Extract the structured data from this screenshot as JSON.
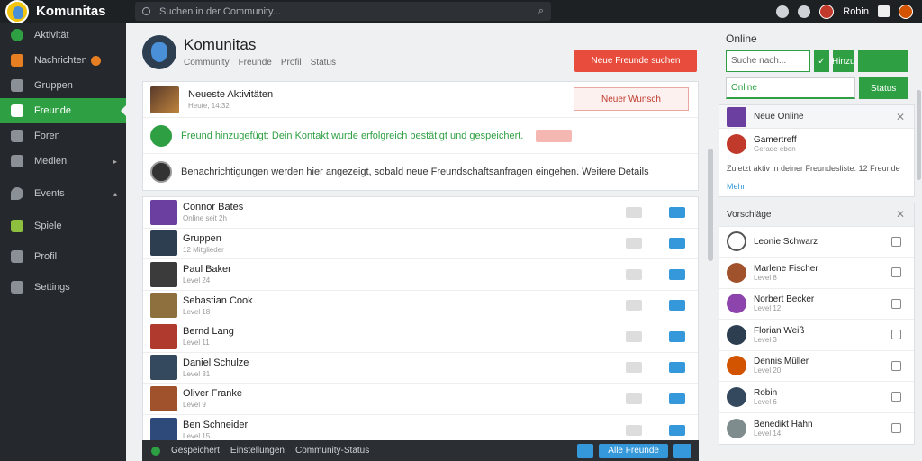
{
  "app": {
    "title": "Komunitas"
  },
  "search": {
    "placeholder": "Suchen in der Community..."
  },
  "topbar": {
    "user": "Robin"
  },
  "sidebar": {
    "items": [
      {
        "label": "Aktivität",
        "icon": "activity-icon"
      },
      {
        "label": "Nachrichten",
        "icon": "chat-icon",
        "badge": true
      },
      {
        "label": "Gruppen",
        "icon": "group-icon"
      },
      {
        "label": "Freunde",
        "icon": "friends-icon",
        "active": true
      },
      {
        "label": "Foren",
        "icon": "forum-icon"
      },
      {
        "label": "Medien",
        "icon": "media-icon"
      },
      {
        "label": "Events",
        "icon": "event-icon"
      },
      {
        "label": "Spiele",
        "icon": "game-icon"
      },
      {
        "label": "Profil",
        "icon": "profile-icon"
      },
      {
        "label": "Settings",
        "icon": "settings-icon"
      }
    ]
  },
  "header": {
    "title": "Komunitas",
    "sub1": "Community",
    "sub2": "Freunde",
    "sub3": "Profil",
    "sub4": "Status",
    "add_label": "Neue Freunde suchen"
  },
  "feature": {
    "title": "Neueste Aktivitäten",
    "sub": "Heute, 14:32",
    "wish": "Neuer Wunsch",
    "status_line": "Freund hinzugefügt: Dein Kontakt wurde erfolgreich bestätigt und gespeichert.",
    "note_line": "Benachrichtigungen werden hier angezeigt, sobald neue Freundschaftsanfragen eingehen. Weitere Details"
  },
  "list": [
    {
      "name": "Connor Bates",
      "sub": "Online seit 2h",
      "green": false
    },
    {
      "name": "Gruppen",
      "sub": "12 Mitglieder",
      "green": true
    },
    {
      "name": "Paul Baker",
      "sub": "Level 24",
      "green": false
    },
    {
      "name": "Sebastian Cook",
      "sub": "Level 18",
      "green": false
    },
    {
      "name": "Bernd Lang",
      "sub": "Level 11",
      "green": false
    },
    {
      "name": "Daniel Schulze",
      "sub": "Level 31",
      "green": false
    },
    {
      "name": "Oliver Franke",
      "sub": "Level 9",
      "green": true
    },
    {
      "name": "Ben Schneider",
      "sub": "Level 15",
      "green": false
    }
  ],
  "bottombar": {
    "text1": "Gespeichert",
    "text2": "Einstellungen",
    "text3": "Community-Status",
    "btn": "Alle Freunde"
  },
  "right": {
    "online_title": "Online",
    "input": "Suche nach...",
    "btn_add": "Hinzu",
    "btn_online": "Online",
    "btn_status": "Status",
    "card1_title": "Neue Online",
    "card1_name": "Gamertreff",
    "card1_sub": "Gerade eben",
    "card1_line": "Zuletzt aktiv in deiner Freundesliste: 12 Freunde",
    "card1_link": "Mehr",
    "card2_title": "Vorschläge",
    "people": [
      {
        "name": "Leonie Schwarz",
        "sub": ""
      },
      {
        "name": "Marlene Fischer",
        "sub": "Level 8"
      },
      {
        "name": "Norbert Becker",
        "sub": "Level 12"
      },
      {
        "name": "Florian Weiß",
        "sub": "Level 3"
      },
      {
        "name": "Dennis Müller",
        "sub": "Level 20"
      },
      {
        "name": "Robin",
        "sub": "Level 6"
      },
      {
        "name": "Benedikt Hahn",
        "sub": "Level 14"
      }
    ]
  }
}
